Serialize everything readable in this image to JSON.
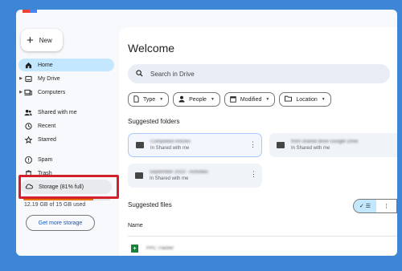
{
  "brand_colors": [
    "#ea4335",
    "#4285f4"
  ],
  "sidebar": {
    "new_label": "New",
    "items": [
      {
        "label": "Home",
        "icon": "home-icon",
        "active": true,
        "expandable": false
      },
      {
        "label": "My Drive",
        "icon": "my-drive-icon",
        "active": false,
        "expandable": true
      },
      {
        "label": "Computers",
        "icon": "computers-icon",
        "active": false,
        "expandable": true
      },
      {
        "label": "Shared with me",
        "icon": "shared-icon",
        "active": false,
        "expandable": false
      },
      {
        "label": "Recent",
        "icon": "clock-icon",
        "active": false,
        "expandable": false
      },
      {
        "label": "Starred",
        "icon": "star-icon",
        "active": false,
        "expandable": false
      },
      {
        "label": "Spam",
        "icon": "spam-icon",
        "active": false,
        "expandable": false
      },
      {
        "label": "Trash",
        "icon": "trash-icon",
        "active": false,
        "expandable": false
      }
    ],
    "storage": {
      "label": "Storage (81% full)",
      "icon": "cloud-icon",
      "usage_fraction": 0.81,
      "bar_color": "#e8710a",
      "usage_text": "12.19 GB of 15 GB used",
      "button_label": "Get more storage"
    },
    "highlight_color": "#d3202a"
  },
  "main": {
    "title": "Welcome",
    "search_placeholder": "Search in Drive",
    "filters": [
      {
        "label": "Type",
        "icon": "file-icon"
      },
      {
        "label": "People",
        "icon": "person-icon"
      },
      {
        "label": "Modified",
        "icon": "calendar-icon"
      },
      {
        "label": "Location",
        "icon": "folder-icon"
      }
    ],
    "suggested_folders_title": "Suggested folders",
    "folders": [
      {
        "name": "Completed Articles",
        "location": "In Shared with me",
        "selected": true
      },
      {
        "name": "from shared drive Google Drive",
        "location": "In Shared with me",
        "selected": false
      },
      {
        "name": "September 2023 - Activities",
        "location": "In Shared with me",
        "selected": false
      }
    ],
    "suggested_files_title": "Suggested files",
    "name_column": "Name",
    "files": [
      {
        "name": "PPC Tracker",
        "icon": "sheets-icon"
      }
    ]
  }
}
